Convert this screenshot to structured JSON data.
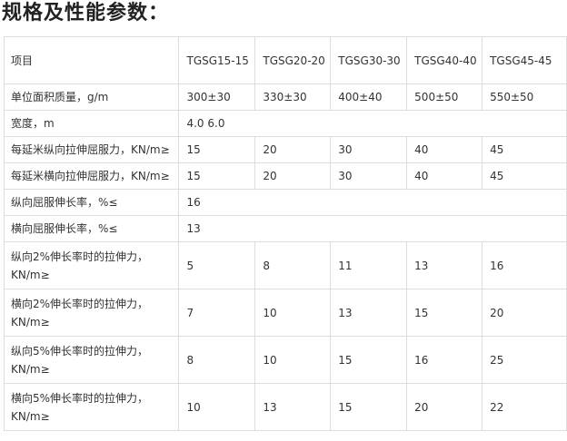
{
  "page": {
    "title": "规格及性能参数："
  },
  "table": {
    "header_label": "项目",
    "headers": [
      "TGSG15-15",
      "TGSG20-20",
      "TGSG30-30",
      "TGSG40-40",
      "TGSG45-45"
    ],
    "rows": [
      {
        "label": "单位面积质量，g/m",
        "values": [
          "300±30",
          "330±30",
          "400±40",
          "500±50",
          "550±50"
        ]
      },
      {
        "label": "宽度，m",
        "values": [
          "4.0 6.0"
        ]
      },
      {
        "label": "每延米纵向拉伸屈服力，KN/m≥",
        "values": [
          "15",
          "20",
          "30",
          "40",
          "45"
        ]
      },
      {
        "label": "每延米横向拉伸屈服力，KN/m≥",
        "values": [
          "15",
          "20",
          "30",
          "40",
          "45"
        ]
      },
      {
        "label": "纵向屈服伸长率，%≤",
        "values": [
          "16"
        ]
      },
      {
        "label": "横向屈服伸长率，%≤",
        "values": [
          "13"
        ]
      },
      {
        "label": "纵向2%伸长率时的拉伸力，KN/m≥",
        "values": [
          "5",
          "8",
          "11",
          "13",
          "16"
        ]
      },
      {
        "label": "横向2%伸长率时的拉伸力，KN/m≥",
        "values": [
          "7",
          "10",
          "13",
          "15",
          "20"
        ]
      },
      {
        "label": "纵向5%伸长率时的拉伸力，KN/m≥",
        "values": [
          "8",
          "10",
          "15",
          "16",
          "25"
        ]
      },
      {
        "label": "横向5%伸长率时的拉伸力，KN/m≥",
        "values": [
          "10",
          "13",
          "15",
          "20",
          "22"
        ]
      }
    ]
  }
}
